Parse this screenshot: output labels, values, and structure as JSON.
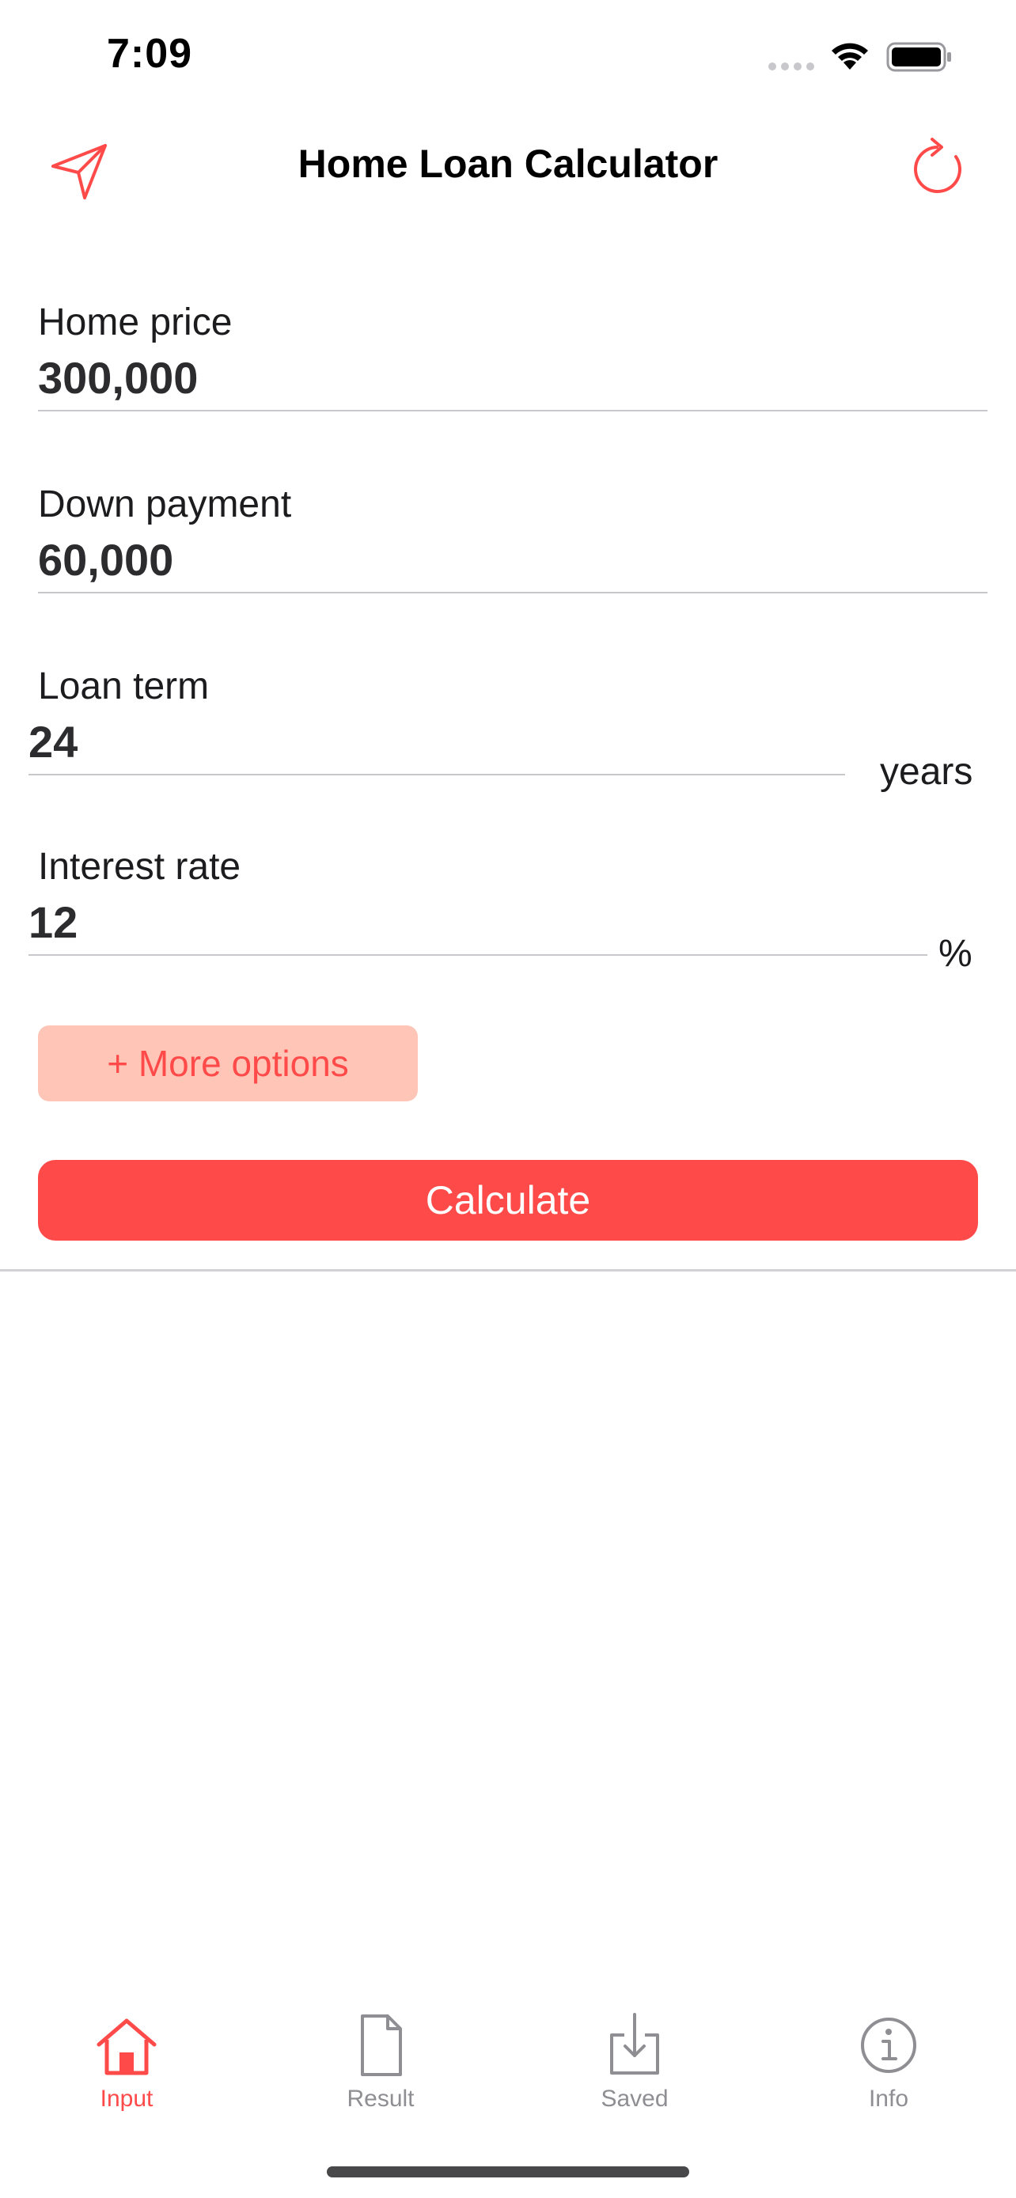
{
  "status_bar": {
    "time": "7:09"
  },
  "header": {
    "title": "Home Loan Calculator",
    "left_icon": "send-icon",
    "right_icon": "refresh-icon"
  },
  "form": {
    "home_price": {
      "label": "Home price",
      "value": "300,000"
    },
    "down_payment": {
      "label": "Down payment",
      "value": "60,000"
    },
    "loan_term": {
      "label": "Loan term",
      "value": "24",
      "unit": "years"
    },
    "interest_rate": {
      "label": "Interest rate",
      "value": "12",
      "unit": "%"
    },
    "more_options_label": "+ More options",
    "calculate_label": "Calculate"
  },
  "tabs": [
    {
      "label": "Input",
      "icon": "home-icon",
      "active": true
    },
    {
      "label": "Result",
      "icon": "document-icon",
      "active": false
    },
    {
      "label": "Saved",
      "icon": "download-icon",
      "active": false
    },
    {
      "label": "Info",
      "icon": "info-icon",
      "active": false
    }
  ],
  "colors": {
    "accent": "#ff4a4a",
    "accent_light": "#ffc6b8",
    "inactive": "#8e8e93"
  }
}
